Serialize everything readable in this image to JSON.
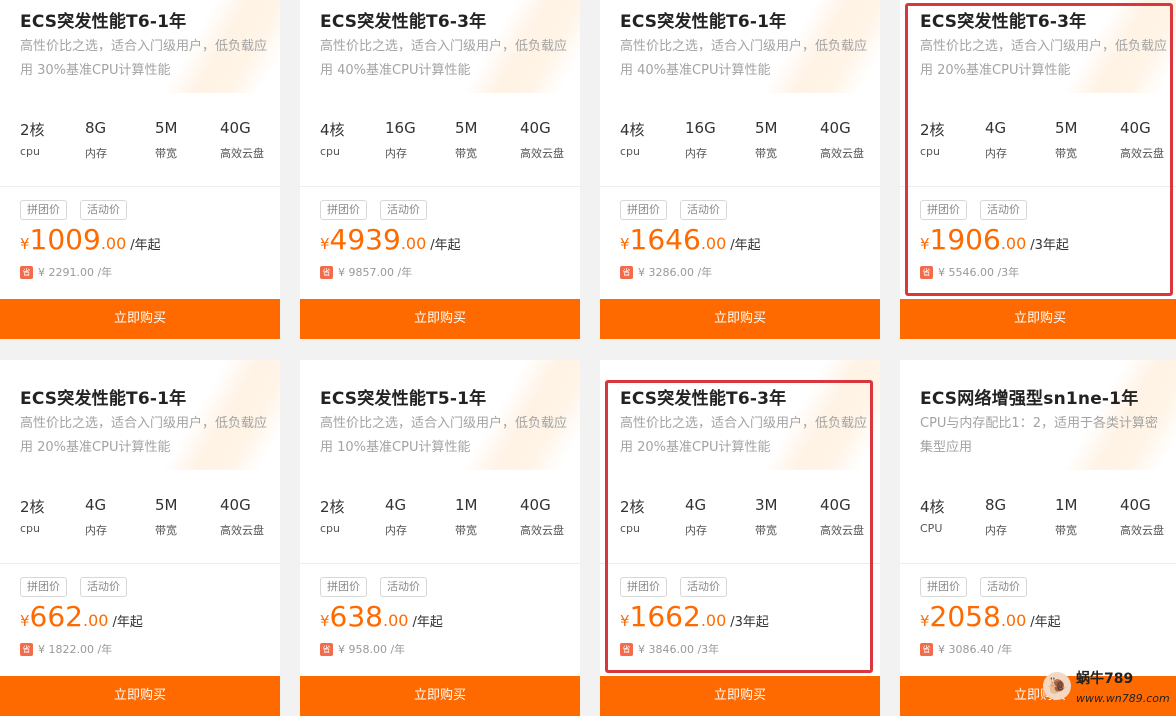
{
  "cards": [
    {
      "title": "ECS突发性能T6-1年",
      "desc": "高性价比之选，适合入门级用户，低负载应用 30%基准CPU计算性能",
      "specs": [
        {
          "value": "2核",
          "unit": "cpu"
        },
        {
          "value": "8G",
          "unit": "内存"
        },
        {
          "value": "5M",
          "unit": "带宽"
        },
        {
          "value": "40G",
          "unit": "高效云盘"
        }
      ],
      "tags": [
        "拼团价",
        "活动价"
      ],
      "currency": "¥",
      "price_int": "1009",
      "price_dec": ".00",
      "price_period": "/年起",
      "save_icon": "省",
      "original": "¥ 2291.00 /年",
      "buy_label": "立即购买"
    },
    {
      "title": "ECS突发性能T6-3年",
      "desc": "高性价比之选，适合入门级用户，低负载应用 40%基准CPU计算性能",
      "specs": [
        {
          "value": "4核",
          "unit": "cpu"
        },
        {
          "value": "16G",
          "unit": "内存"
        },
        {
          "value": "5M",
          "unit": "带宽"
        },
        {
          "value": "40G",
          "unit": "高效云盘"
        }
      ],
      "tags": [
        "拼团价",
        "活动价"
      ],
      "currency": "¥",
      "price_int": "4939",
      "price_dec": ".00",
      "price_period": "/年起",
      "save_icon": "省",
      "original": "¥ 9857.00 /年",
      "buy_label": "立即购买"
    },
    {
      "title": "ECS突发性能T6-1年",
      "desc": "高性价比之选，适合入门级用户，低负载应用 40%基准CPU计算性能",
      "specs": [
        {
          "value": "4核",
          "unit": "cpu"
        },
        {
          "value": "16G",
          "unit": "内存"
        },
        {
          "value": "5M",
          "unit": "带宽"
        },
        {
          "value": "40G",
          "unit": "高效云盘"
        }
      ],
      "tags": [
        "拼团价",
        "活动价"
      ],
      "currency": "¥",
      "price_int": "1646",
      "price_dec": ".00",
      "price_period": "/年起",
      "save_icon": "省",
      "original": "¥ 3286.00 /年",
      "buy_label": "立即购买"
    },
    {
      "title": "ECS突发性能T6-3年",
      "desc": "高性价比之选，适合入门级用户，低负载应用 20%基准CPU计算性能",
      "specs": [
        {
          "value": "2核",
          "unit": "cpu"
        },
        {
          "value": "4G",
          "unit": "内存"
        },
        {
          "value": "5M",
          "unit": "带宽"
        },
        {
          "value": "40G",
          "unit": "高效云盘"
        }
      ],
      "tags": [
        "拼团价",
        "活动价"
      ],
      "currency": "¥",
      "price_int": "1906",
      "price_dec": ".00",
      "price_period": "/3年起",
      "save_icon": "省",
      "original": "¥ 5546.00 /3年",
      "buy_label": "立即购买",
      "highlighted": true
    },
    {
      "title": "ECS突发性能T6-1年",
      "desc": "高性价比之选，适合入门级用户，低负载应用 20%基准CPU计算性能",
      "specs": [
        {
          "value": "2核",
          "unit": "cpu"
        },
        {
          "value": "4G",
          "unit": "内存"
        },
        {
          "value": "5M",
          "unit": "带宽"
        },
        {
          "value": "40G",
          "unit": "高效云盘"
        }
      ],
      "tags": [
        "拼团价",
        "活动价"
      ],
      "currency": "¥",
      "price_int": "662",
      "price_dec": ".00",
      "price_period": "/年起",
      "save_icon": "省",
      "original": "¥ 1822.00 /年",
      "buy_label": "立即购买"
    },
    {
      "title": "ECS突发性能T5-1年",
      "desc": "高性价比之选，适合入门级用户，低负载应用 10%基准CPU计算性能",
      "specs": [
        {
          "value": "2核",
          "unit": "cpu"
        },
        {
          "value": "4G",
          "unit": "内存"
        },
        {
          "value": "1M",
          "unit": "带宽"
        },
        {
          "value": "40G",
          "unit": "高效云盘"
        }
      ],
      "tags": [
        "拼团价",
        "活动价"
      ],
      "currency": "¥",
      "price_int": "638",
      "price_dec": ".00",
      "price_period": "/年起",
      "save_icon": "省",
      "original": "¥ 958.00 /年",
      "buy_label": "立即购买"
    },
    {
      "title": "ECS突发性能T6-3年",
      "desc": "高性价比之选，适合入门级用户，低负载应用 20%基准CPU计算性能",
      "specs": [
        {
          "value": "2核",
          "unit": "cpu"
        },
        {
          "value": "4G",
          "unit": "内存"
        },
        {
          "value": "3M",
          "unit": "带宽"
        },
        {
          "value": "40G",
          "unit": "高效云盘"
        }
      ],
      "tags": [
        "拼团价",
        "活动价"
      ],
      "currency": "¥",
      "price_int": "1662",
      "price_dec": ".00",
      "price_period": "/3年起",
      "save_icon": "省",
      "original": "¥ 3846.00 /3年",
      "buy_label": "立即购买",
      "highlighted": true
    },
    {
      "title": "ECS网络增强型sn1ne-1年",
      "desc": "CPU与内存配比1：2，适用于各类计算密集型应用",
      "specs": [
        {
          "value": "4核",
          "unit": "CPU"
        },
        {
          "value": "8G",
          "unit": "内存"
        },
        {
          "value": "1M",
          "unit": "带宽"
        },
        {
          "value": "40G",
          "unit": "高效云盘"
        }
      ],
      "tags": [
        "拼团价",
        "活动价"
      ],
      "currency": "¥",
      "price_int": "2058",
      "price_dec": ".00",
      "price_period": "/年起",
      "save_icon": "省",
      "original": "¥ 3086.40 /年",
      "buy_label": "立即购买"
    }
  ],
  "watermark": {
    "brand": "蜗牛789",
    "url": "www.wn789.com",
    "icon": "snail-icon"
  },
  "colors": {
    "accent": "#ff6a00",
    "highlight": "#d9363e",
    "save_badge": "#f26b4b"
  }
}
